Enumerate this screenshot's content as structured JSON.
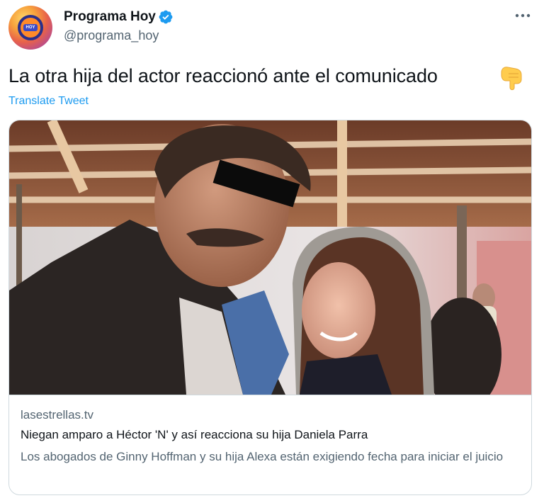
{
  "author": {
    "display_name": "Programa Hoy",
    "handle": "@programa_hoy",
    "avatar_icon": "programa-hoy-logo",
    "verified_icon": "verified-badge-icon",
    "verified_color": "#1d9bf0"
  },
  "more_icon": "ellipsis-icon",
  "tweet": {
    "text": "La otra hija del actor reaccionó ante el comunicado",
    "emoji": "backhand-index-pointing-down",
    "translate_label": "Translate Tweet"
  },
  "link_card": {
    "domain": "lasestrellas.tv",
    "title": "Niegan amparo a Héctor 'N' y así reacciona su hija Daniela Parra",
    "description": "Los abogados de Ginny Hoffman y su hija Alexa están exigiendo fecha para iniciar el juicio",
    "image": "photo-man-censored-eyes-and-woman-in-hoodie"
  },
  "colors": {
    "accent": "#1d9bf0",
    "text_primary": "#0f1419",
    "text_secondary": "#536471",
    "border": "#cfd9de"
  }
}
